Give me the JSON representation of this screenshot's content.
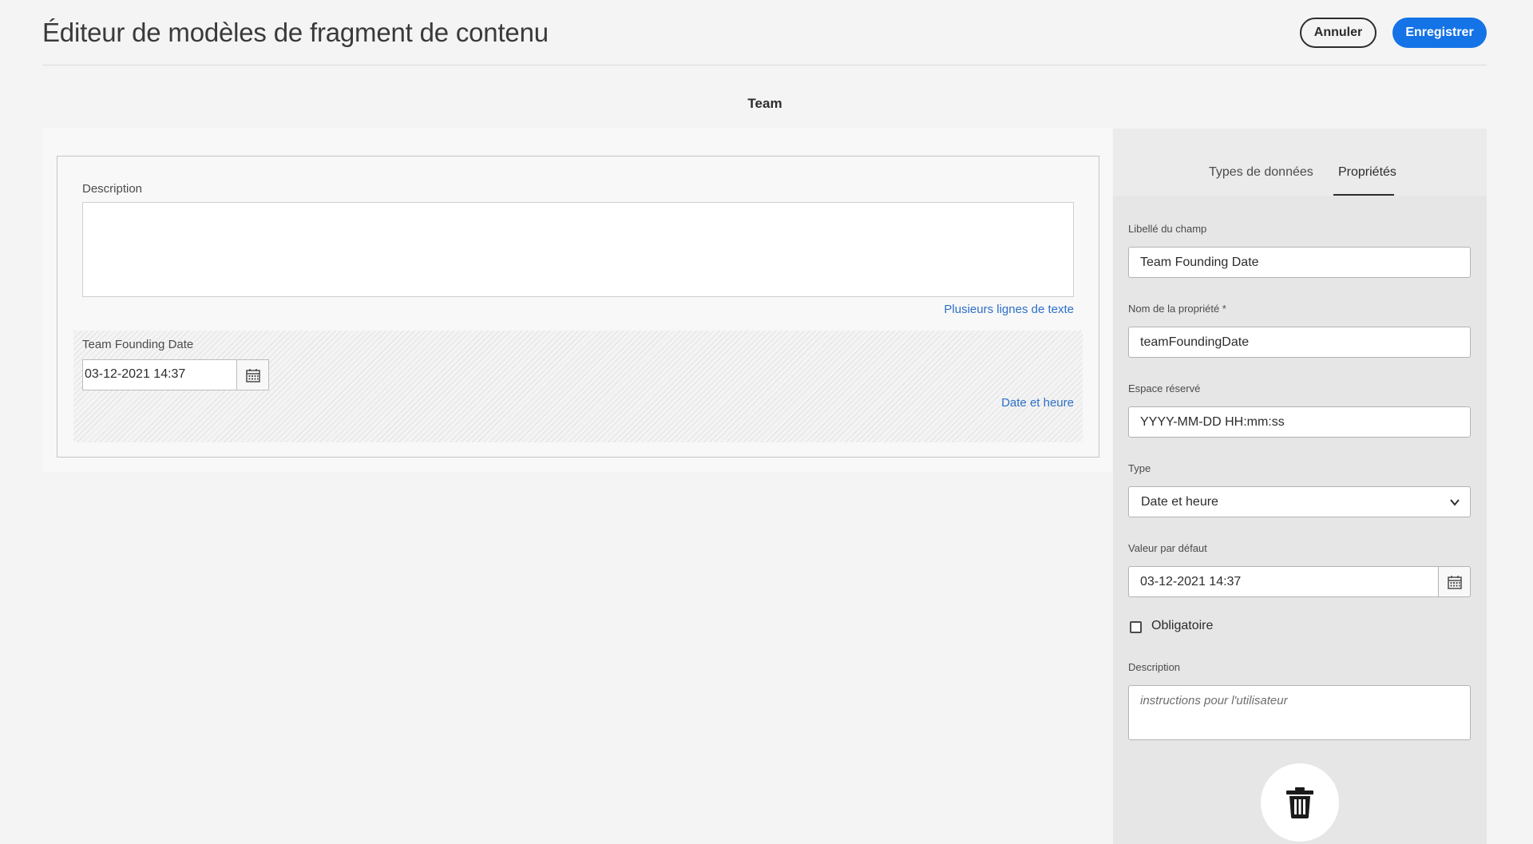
{
  "header": {
    "title": "Éditeur de modèles de fragment de contenu",
    "cancel_label": "Annuler",
    "save_label": "Enregistrer"
  },
  "model": {
    "name": "Team"
  },
  "canvas": {
    "description_label": "Description",
    "description_type": "Plusieurs lignes de texte",
    "date_label": "Team Founding Date",
    "date_value": "03-12-2021 14:37",
    "date_type": "Date et heure"
  },
  "panel": {
    "tabs": [
      {
        "label": "Types de données",
        "active": false
      },
      {
        "label": "Propriétés",
        "active": true
      }
    ],
    "field_label_title": "Libellé du champ",
    "field_label_value": "Team Founding Date",
    "property_name_title": "Nom de la propriété *",
    "property_name_value": "teamFoundingDate",
    "placeholder_title": "Espace réservé",
    "placeholder_value": "YYYY-MM-DD HH:mm:ss",
    "type_title": "Type",
    "type_value": "Date et heure",
    "default_title": "Valeur par défaut",
    "default_value": "03-12-2021 14:37",
    "required_label": "Obligatoire",
    "required_checked": false,
    "description_title": "Description",
    "description_placeholder": "instructions pour l'utilisateur"
  },
  "colors": {
    "accent": "#1473e6",
    "link": "#2d70c9",
    "background": "#f4f4f4",
    "panel": "#e6e6e6"
  },
  "icons": {
    "calendar": "calendar-icon",
    "chevron": "chevron-down-icon",
    "delete": "trash-icon"
  }
}
